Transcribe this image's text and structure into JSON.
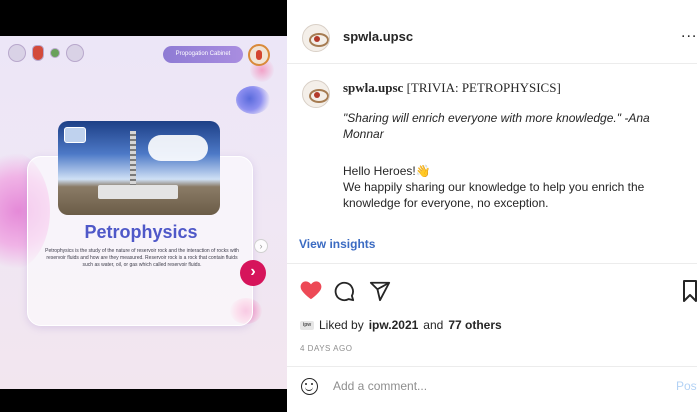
{
  "post_media": {
    "cabinet_label": "Propogation Cabinet",
    "title": "Petrophysics",
    "description": "Petrophysics is the study of the nature of reservoir rock and the interaction of rocks with reservoir fluids and how are they measured. Reservoir rock is a rock that contain fluids such as water, oil, or gas which called reservoir fluids."
  },
  "header": {
    "username": "spwla.upsc",
    "more_label": "..."
  },
  "caption": {
    "username": "spwla.upsc",
    "heading": "[TRIVIA: PETROPHYSICS]",
    "quote": "\"Sharing will enrich everyone with more knowledge.\" -Ana Monnar",
    "greeting": "Hello Heroes!👋",
    "body": "We happily sharing our knowledge to help you enrich the knowledge for everyone, no exception."
  },
  "insights_label": "View insights",
  "likes": {
    "avatar_text": "ipw",
    "prefix": "Liked by",
    "user": "ipw.2021",
    "connector": "and",
    "others": "77 others"
  },
  "timestamp": "4 DAYS AGO",
  "comment": {
    "placeholder": "Add a comment...",
    "post_label": "Post"
  },
  "colors": {
    "heart": "#ed4956",
    "link": "#3b6bc2",
    "slide_title": "#4f58c8",
    "nav_button": "#d6145b"
  },
  "icons": [
    "heart-icon",
    "comment-icon",
    "send-icon",
    "save-icon",
    "emoji-icon",
    "more-icon"
  ]
}
